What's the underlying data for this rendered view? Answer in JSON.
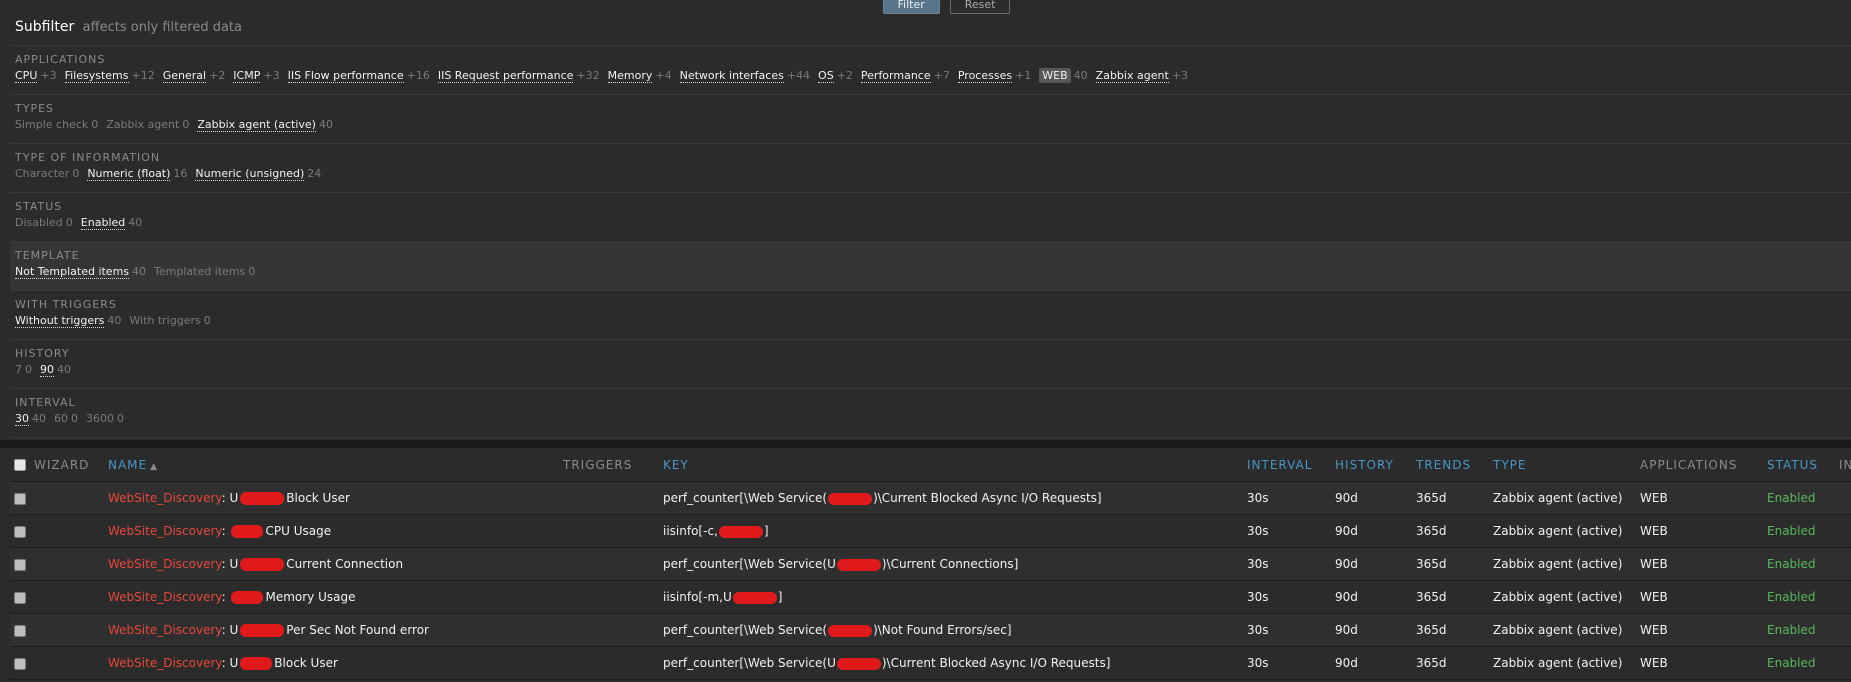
{
  "buttons": {
    "filter": "Filter",
    "reset": "Reset"
  },
  "subfilter": {
    "title": "Subfilter",
    "subtitle": "affects only filtered data",
    "groups": [
      {
        "title": "APPLICATIONS",
        "items": [
          {
            "label": "CPU",
            "count": "+3",
            "kind": "link"
          },
          {
            "label": "Filesystems",
            "count": "+12",
            "kind": "link"
          },
          {
            "label": "General",
            "count": "+2",
            "kind": "link"
          },
          {
            "label": "ICMP",
            "count": "+3",
            "kind": "link"
          },
          {
            "label": "IIS Flow performance",
            "count": "+16",
            "kind": "link"
          },
          {
            "label": "IIS Request performance",
            "count": "+32",
            "kind": "link"
          },
          {
            "label": "Memory",
            "count": "+4",
            "kind": "link"
          },
          {
            "label": "Network interfaces",
            "count": "+44",
            "kind": "link"
          },
          {
            "label": "OS",
            "count": "+2",
            "kind": "link"
          },
          {
            "label": "Performance",
            "count": "+7",
            "kind": "link"
          },
          {
            "label": "Processes",
            "count": "+1",
            "kind": "link"
          },
          {
            "label": "WEB",
            "count": "40",
            "kind": "selected"
          },
          {
            "label": "Zabbix agent",
            "count": "+3",
            "kind": "link"
          }
        ]
      },
      {
        "title": "TYPES",
        "items": [
          {
            "label": "Simple check",
            "count": "0",
            "kind": "static"
          },
          {
            "label": "Zabbix agent",
            "count": "0",
            "kind": "static"
          },
          {
            "label": "Zabbix agent (active)",
            "count": "40",
            "kind": "link"
          }
        ]
      },
      {
        "title": "TYPE OF INFORMATION",
        "items": [
          {
            "label": "Character",
            "count": "0",
            "kind": "static"
          },
          {
            "label": "Numeric (float)",
            "count": "16",
            "kind": "link"
          },
          {
            "label": "Numeric (unsigned)",
            "count": "24",
            "kind": "link"
          }
        ]
      },
      {
        "title": "STATUS",
        "items": [
          {
            "label": "Disabled",
            "count": "0",
            "kind": "static"
          },
          {
            "label": "Enabled",
            "count": "40",
            "kind": "link"
          }
        ]
      },
      {
        "title": "TEMPLATE",
        "highlight": true,
        "items": [
          {
            "label": "Not Templated items",
            "count": "40",
            "kind": "link"
          },
          {
            "label": "Templated items",
            "count": "0",
            "kind": "static"
          }
        ]
      },
      {
        "title": "WITH TRIGGERS",
        "items": [
          {
            "label": "Without triggers",
            "count": "40",
            "kind": "link"
          },
          {
            "label": "With triggers",
            "count": "0",
            "kind": "static"
          }
        ]
      },
      {
        "title": "HISTORY",
        "items": [
          {
            "label": "7",
            "count": "0",
            "kind": "static"
          },
          {
            "label": "90",
            "count": "40",
            "kind": "link"
          }
        ]
      },
      {
        "title": "INTERVAL",
        "items": [
          {
            "label": "30",
            "count": "40",
            "kind": "link"
          },
          {
            "label": "60",
            "count": "0",
            "kind": "static"
          },
          {
            "label": "3600",
            "count": "0",
            "kind": "static"
          }
        ]
      }
    ]
  },
  "table": {
    "headers": {
      "wizard": "WIZARD",
      "name": "NAME",
      "sort_arrow": "▲",
      "triggers": "TRIGGERS",
      "key": "KEY",
      "interval": "INTERVAL",
      "history": "HISTORY",
      "trends": "TRENDS",
      "type": "TYPE",
      "applications": "APPLICATIONS",
      "status": "STATUS",
      "info": "IN"
    },
    "rows": [
      {
        "name_prefix": "WebSite_Discovery",
        "name_sep": ": ",
        "name_start": "U",
        "name_rest": "Block User",
        "key_start": "perf_counter[\\Web Service(",
        "key_end": ")\\Current Blocked Async I/O Requests]",
        "interval": "30s",
        "history": "90d",
        "trends": "365d",
        "type": "Zabbix agent (active)",
        "application": "WEB",
        "status": "Enabled"
      },
      {
        "name_prefix": "WebSite_Discovery",
        "name_sep": ": ",
        "name_start": "",
        "name_rest": "CPU Usage",
        "key_start": "iisinfo[-c,",
        "key_end": "]",
        "interval": "30s",
        "history": "90d",
        "trends": "365d",
        "type": "Zabbix agent (active)",
        "application": "WEB",
        "status": "Enabled"
      },
      {
        "name_prefix": "WebSite_Discovery",
        "name_sep": ": ",
        "name_start": "U",
        "name_rest": "Current Connection",
        "key_start": "perf_counter[\\Web Service(U",
        "key_end": ")\\Current Connections]",
        "interval": "30s",
        "history": "90d",
        "trends": "365d",
        "type": "Zabbix agent (active)",
        "application": "WEB",
        "status": "Enabled"
      },
      {
        "name_prefix": "WebSite_Discovery",
        "name_sep": ": ",
        "name_start": "",
        "name_rest": "Memory Usage",
        "key_start": "iisinfo[-m,U",
        "key_end": "]",
        "interval": "30s",
        "history": "90d",
        "trends": "365d",
        "type": "Zabbix agent (active)",
        "application": "WEB",
        "status": "Enabled"
      },
      {
        "name_prefix": "WebSite_Discovery",
        "name_sep": ": ",
        "name_start": "U",
        "name_rest": "Per Sec Not Found error",
        "key_start": "perf_counter[\\Web Service(",
        "key_end": ")\\Not Found Errors/sec]",
        "interval": "30s",
        "history": "90d",
        "trends": "365d",
        "type": "Zabbix agent (active)",
        "application": "WEB",
        "status": "Enabled"
      },
      {
        "name_prefix": "WebSite_Discovery",
        "name_sep": ": ",
        "name_start": "U",
        "name_rest": "Block User",
        "key_start": "perf_counter[\\Web Service(U",
        "key_end": ")\\Current Blocked Async I/O Requests]",
        "interval": "30s",
        "history": "90d",
        "trends": "365d",
        "type": "Zabbix agent (active)",
        "application": "WEB",
        "status": "Enabled"
      }
    ]
  },
  "colors": {
    "background": "#2b2b2b",
    "accent_link": "#4796c4",
    "name_link": "#e54839",
    "status_enabled": "#59b85a",
    "redaction": "#e01a1a"
  }
}
